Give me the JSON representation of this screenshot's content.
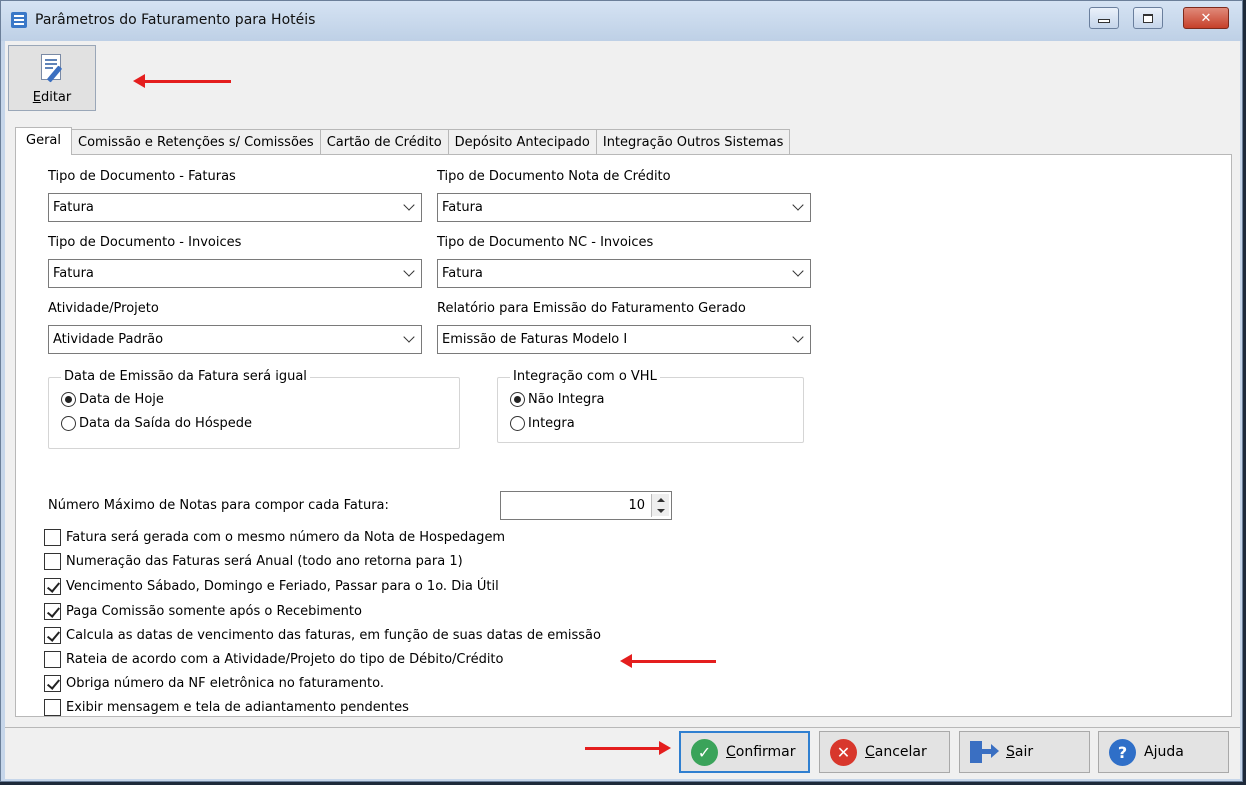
{
  "window": {
    "title": "Parâmetros do Faturamento para Hotéis"
  },
  "toolbar": {
    "edit_label": "Editar"
  },
  "tabs": [
    "Geral",
    "Comissão e Retenções s/ Comissões",
    "Cartão de Crédito",
    "Depósito Antecipado",
    "Integração Outros Sistemas"
  ],
  "fields": {
    "doc_faturas": {
      "label": "Tipo de Documento - Faturas",
      "value": "Fatura"
    },
    "doc_nota_credito": {
      "label": "Tipo de Documento Nota de Crédito",
      "value": "Fatura"
    },
    "doc_invoices": {
      "label": "Tipo de Documento - Invoices",
      "value": "Fatura"
    },
    "doc_nc_invoices": {
      "label": "Tipo de Documento NC - Invoices",
      "value": "Fatura"
    },
    "atividade": {
      "label": "Atividade/Projeto",
      "value": "Atividade Padrão"
    },
    "relatorio": {
      "label": "Relatório para Emissão do Faturamento Gerado",
      "value": "Emissão de Faturas Modelo I"
    }
  },
  "groups": {
    "data_emissao": {
      "title": "Data de Emissão da Fatura será igual",
      "options": [
        "Data de Hoje",
        "Data da Saída do Hóspede"
      ]
    },
    "vhl": {
      "title": "Integração com o VHL",
      "options": [
        "Não Integra",
        "Integra"
      ]
    }
  },
  "max_notas": {
    "label": "Número Máximo de Notas para compor cada Fatura:",
    "value": "10"
  },
  "checkboxes": [
    {
      "label": "Fatura será gerada com o mesmo número da Nota de Hospedagem",
      "checked": false
    },
    {
      "label": "Numeração das Faturas será Anual (todo ano retorna para 1)",
      "checked": false
    },
    {
      "label": "Vencimento Sábado, Domingo e Feriado, Passar para o 1o. Dia Útil",
      "checked": true
    },
    {
      "label": "Paga Comissão somente após o Recebimento",
      "checked": true
    },
    {
      "label": "Calcula as datas de vencimento das faturas,  em função de suas datas de emissão",
      "checked": true
    },
    {
      "label": "Rateia de acordo com a Atividade/Projeto do tipo de Débito/Crédito",
      "checked": false
    },
    {
      "label": "Obriga número da NF eletrônica no faturamento.",
      "checked": true
    },
    {
      "label": "Exibir mensagem e tela de adiantamento pendentes",
      "checked": false
    }
  ],
  "buttons": {
    "confirmar": "Confirmar",
    "cancelar": "Cancelar",
    "sair": "Sair",
    "ajuda": "Ajuda"
  },
  "colors": {
    "annotation_arrow": "#e41e1e",
    "focus": "#2f7fd0"
  }
}
